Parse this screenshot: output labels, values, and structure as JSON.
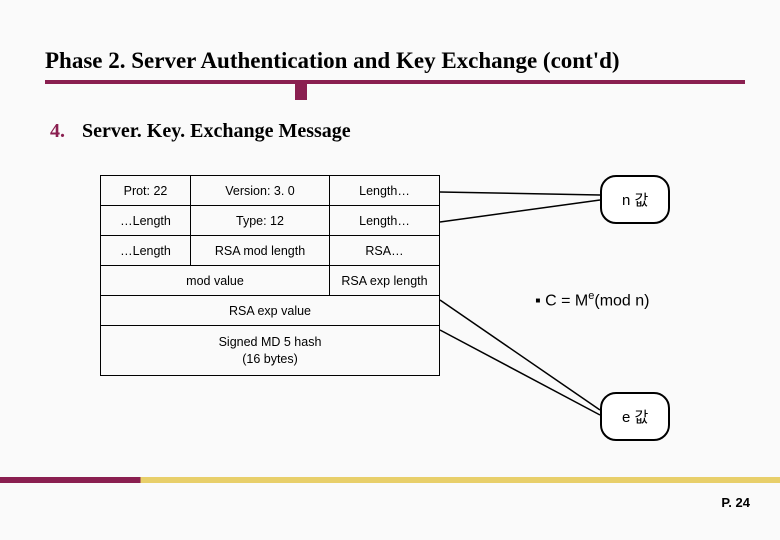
{
  "title": "Phase 2. Server Authentication and Key Exchange (cont'd)",
  "section": {
    "num": "4.",
    "text": "Server. Key. Exchange Message"
  },
  "table": {
    "r1": {
      "c1": "Prot: 22",
      "c2": "Version: 3. 0",
      "c3": "Length…"
    },
    "r2": {
      "c1": "…Length",
      "c2": "Type: 12",
      "c3": "Length…"
    },
    "r3": {
      "c1": "…Length",
      "c2": "RSA mod length",
      "c3": "RSA…"
    },
    "r4": {
      "c1": "mod value",
      "c2": "RSA exp length"
    },
    "r5": {
      "c1": "RSA exp value"
    },
    "r6": {
      "c1": "Signed MD 5 hash\n(16 bytes)"
    }
  },
  "callouts": {
    "n": "n 값",
    "e": "e 값"
  },
  "formula": {
    "bullet": "▪",
    "text_pre": "C = M",
    "exp": "e",
    "text_post": "(mod n)"
  },
  "page": "P. 24"
}
